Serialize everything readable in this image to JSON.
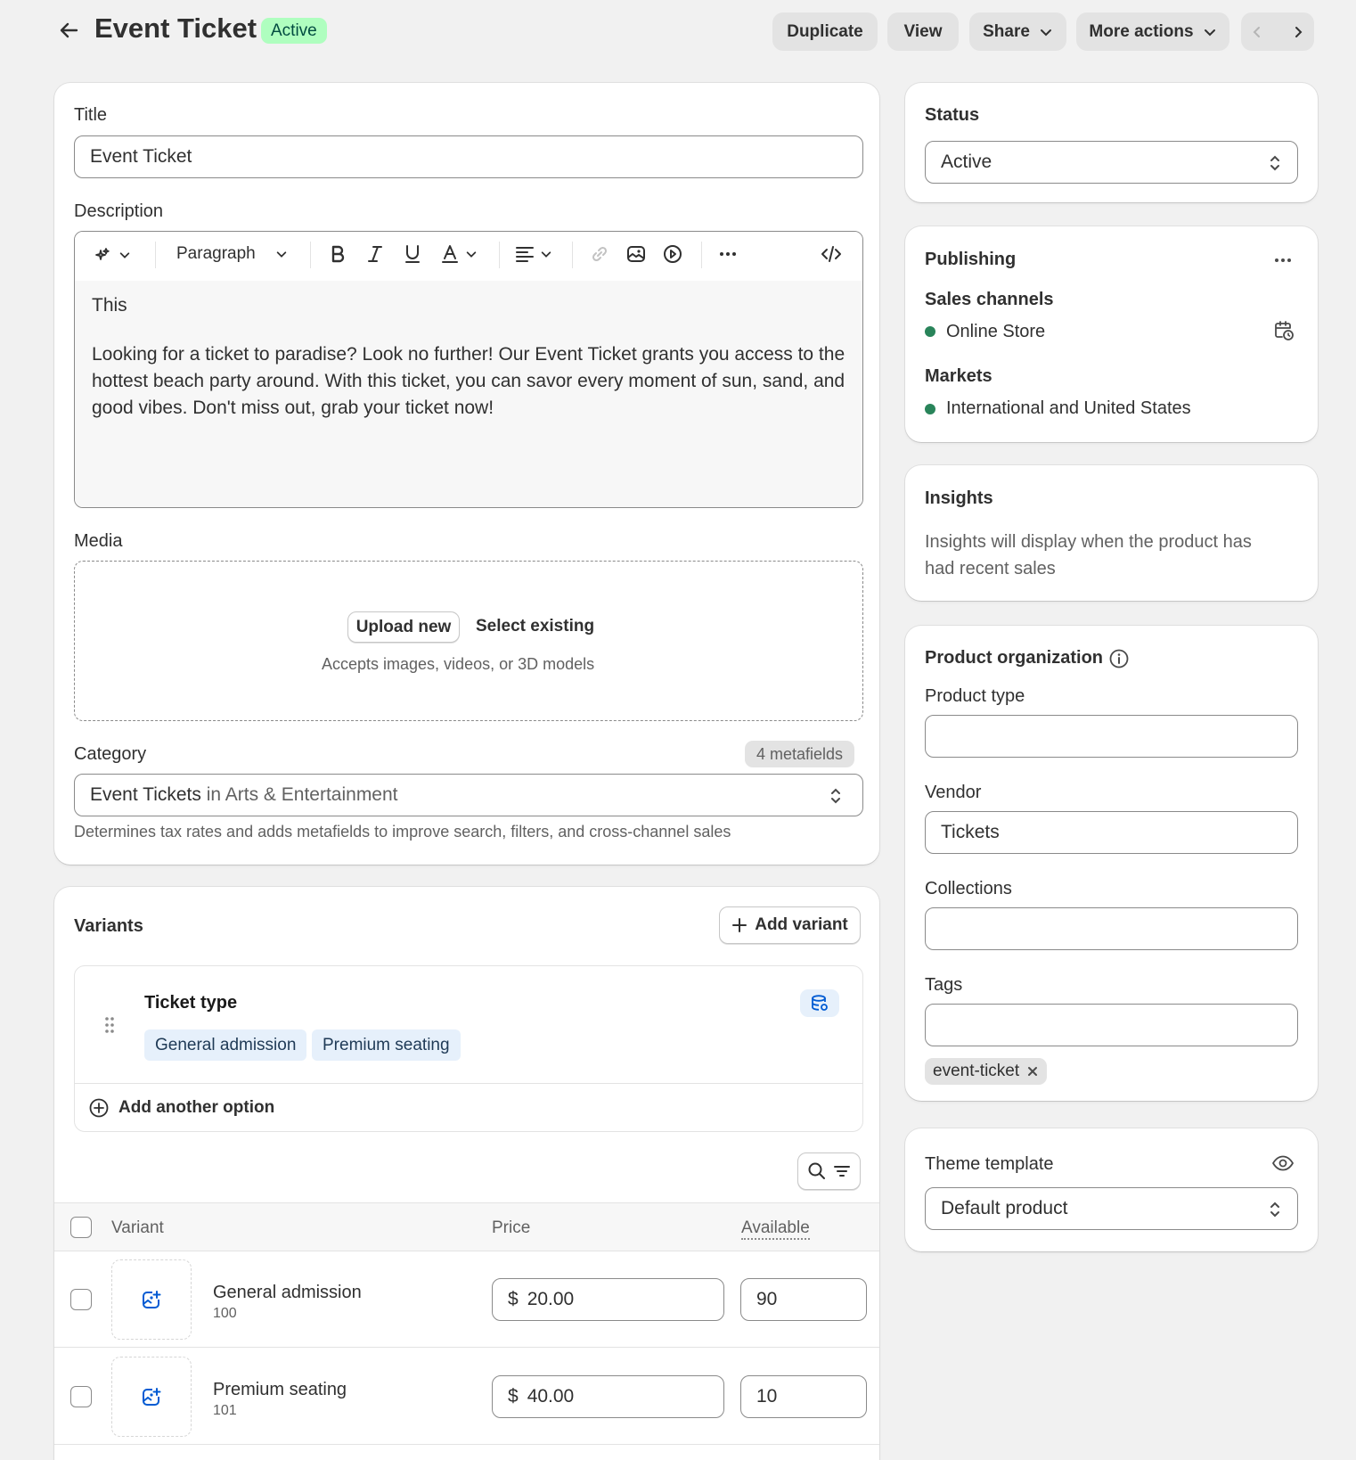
{
  "header": {
    "title": "Event Ticket",
    "status_badge": "Active",
    "actions": {
      "duplicate": "Duplicate",
      "view": "View",
      "share": "Share",
      "more": "More actions"
    }
  },
  "main": {
    "title_label": "Title",
    "title_value": "Event Ticket",
    "description_label": "Description",
    "editor": {
      "paragraph_select": "Paragraph",
      "line1": "This",
      "body": "Looking for a ticket to paradise? Look no further! Our Event Ticket grants you access to the hottest beach party around. With this ticket, you can savor every moment of sun, sand, and good vibes. Don't miss out, grab your ticket now!"
    },
    "media": {
      "label": "Media",
      "upload": "Upload new",
      "select": "Select existing",
      "hint": "Accepts images, videos, or 3D models"
    },
    "category": {
      "label": "Category",
      "metafields": "4 metafields",
      "value": "Event Tickets",
      "value_suffix": "in Arts & Entertainment",
      "help": "Determines tax rates and adds metafields to improve search, filters, and cross-channel sales"
    }
  },
  "variants": {
    "title": "Variants",
    "add_variant": "Add variant",
    "option_name": "Ticket type",
    "option_values": [
      "General admission",
      "Premium seating"
    ],
    "add_option": "Add another option",
    "columns": {
      "variant": "Variant",
      "price": "Price",
      "available": "Available"
    },
    "rows": [
      {
        "name": "General admission",
        "sku": "100",
        "currency": "$",
        "price": "20.00",
        "available": "90"
      },
      {
        "name": "Premium seating",
        "sku": "101",
        "currency": "$",
        "price": "40.00",
        "available": "10"
      }
    ]
  },
  "sidebar": {
    "status": {
      "title": "Status",
      "value": "Active"
    },
    "publishing": {
      "title": "Publishing",
      "sales_channels_label": "Sales channels",
      "sales_channel": "Online Store",
      "markets_label": "Markets",
      "market": "International and United States"
    },
    "insights": {
      "title": "Insights",
      "text": "Insights will display when the product has had recent sales"
    },
    "organization": {
      "title": "Product organization",
      "product_type_label": "Product type",
      "product_type_value": "",
      "vendor_label": "Vendor",
      "vendor_value": "Tickets",
      "collections_label": "Collections",
      "collections_value": "",
      "tags_label": "Tags",
      "tags_value": "",
      "tag": "event-ticket"
    },
    "theme": {
      "title": "Theme template",
      "value": "Default product"
    }
  },
  "colors": {
    "active_badge_bg": "#affebf",
    "active_badge_text": "#014b40",
    "status_dot": "#29845a",
    "chip_bg": "#e6f0fb",
    "accent_blue": "#005bd3"
  },
  "icons": [
    "arrow-left-icon",
    "chevron-down-icon",
    "chevron-left-icon",
    "chevron-right-icon",
    "magic-icon",
    "bold-icon",
    "italic-icon",
    "underline-icon",
    "text-color-icon",
    "align-icon",
    "link-icon",
    "image-icon",
    "video-icon",
    "more-horizontal-icon",
    "code-icon",
    "select-arrows-icon",
    "plus-icon",
    "drag-handle-icon",
    "database-icon",
    "plus-circle-icon",
    "search-icon",
    "filter-icon",
    "image-add-icon",
    "calendar-clock-icon",
    "info-icon",
    "eye-icon",
    "close-icon"
  ]
}
